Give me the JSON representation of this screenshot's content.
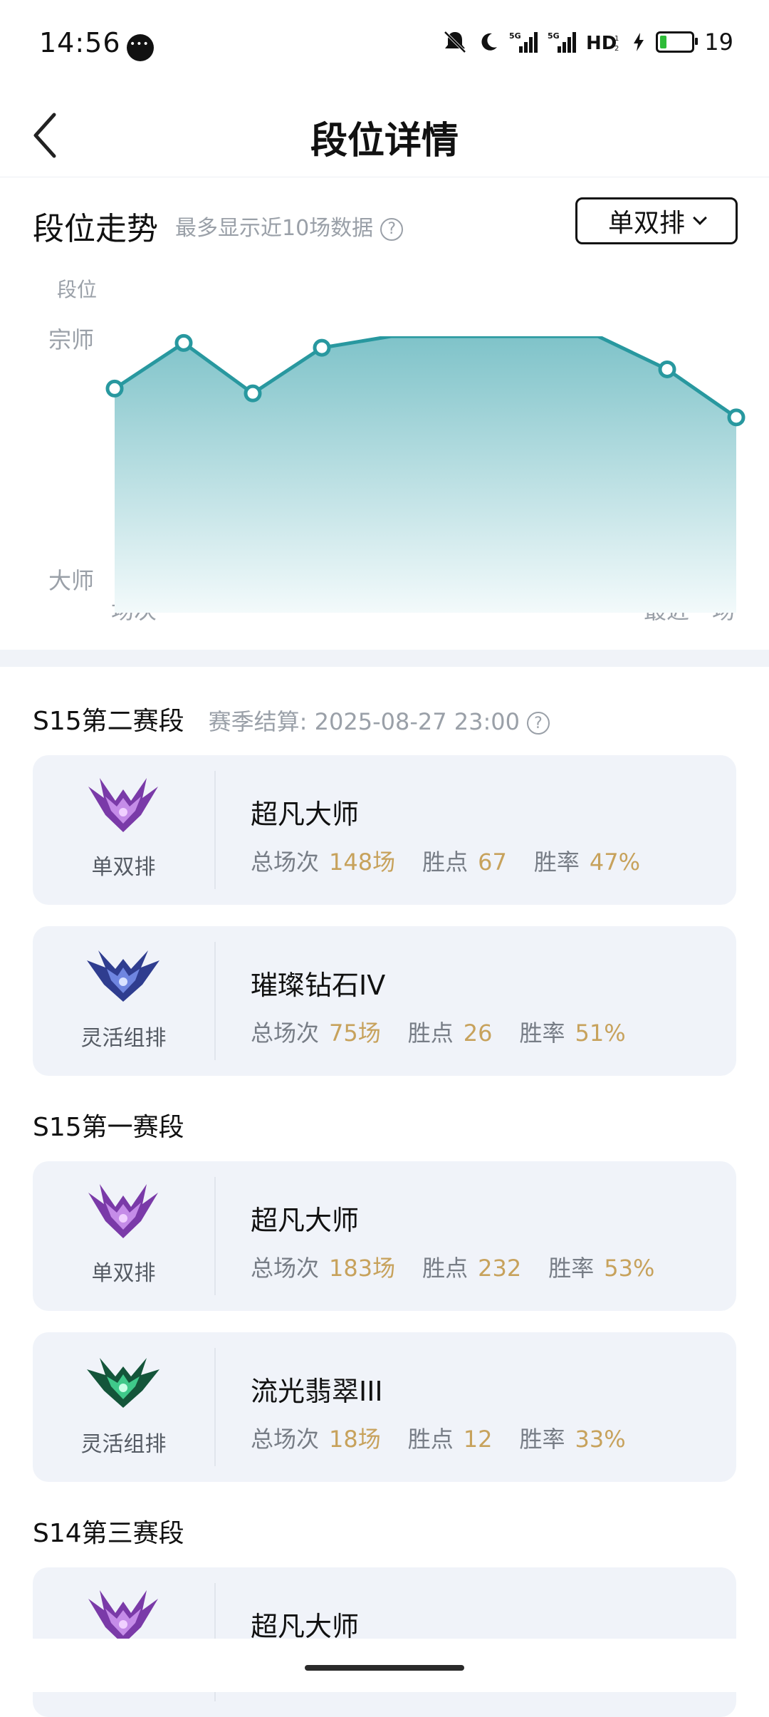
{
  "status_bar": {
    "time": "14:56",
    "network": "5G 5G HD",
    "battery": "19",
    "battery_level": 0.19,
    "icons": [
      "chat-icon",
      "mute-icon",
      "moon-icon",
      "signal-icon",
      "signal-icon",
      "hd-icon",
      "charging-icon",
      "battery-icon"
    ]
  },
  "header": {
    "title": "段位详情",
    "back_icon": "chevron-left-icon"
  },
  "trend": {
    "title": "段位走势",
    "hint": "最多显示近10场数据",
    "help_icon": "question-circle-icon",
    "mode": "单双排",
    "mode_icon": "chevron-down-icon"
  },
  "chart_data": {
    "type": "area",
    "ylabel": "段位",
    "y_ticks": [
      "宗师",
      "大师"
    ],
    "x_ticks": [
      "场次",
      "最近一场"
    ],
    "ylim": [
      0,
      100
    ],
    "grid": false,
    "series": [
      {
        "values": [
          80,
          99,
          78,
          97,
          110,
          110,
          110,
          110,
          88,
          68
        ]
      }
    ],
    "colors": {
      "line": "#28989f",
      "fill_top": "#7fc3c9",
      "fill_bottom": "#f3fafb"
    }
  },
  "seasons": [
    {
      "title": "S15第二赛段",
      "meta": "赛季结算: 2025-08-27 23:00",
      "cards": [
        {
          "queue": "单双排",
          "rank": "超凡大师",
          "games_label": "总场次",
          "games": "148场",
          "lp_label": "胜点",
          "lp": "67",
          "wr_label": "胜率",
          "wr": "47%",
          "emblem": "master-emblem-icon"
        },
        {
          "queue": "灵活组排",
          "rank": "璀璨钻石IV",
          "games_label": "总场次",
          "games": "75场",
          "lp_label": "胜点",
          "lp": "26",
          "wr_label": "胜率",
          "wr": "51%",
          "emblem": "diamond-emblem-icon"
        }
      ]
    },
    {
      "title": "S15第一赛段",
      "cards": [
        {
          "queue": "单双排",
          "rank": "超凡大师",
          "games_label": "总场次",
          "games": "183场",
          "lp_label": "胜点",
          "lp": "232",
          "wr_label": "胜率",
          "wr": "53%",
          "emblem": "master-emblem-icon"
        },
        {
          "queue": "灵活组排",
          "rank": "流光翡翠III",
          "games_label": "总场次",
          "games": "18场",
          "lp_label": "胜点",
          "lp": "12",
          "wr_label": "胜率",
          "wr": "33%",
          "emblem": "emerald-emblem-icon"
        }
      ]
    },
    {
      "title": "S14第三赛段",
      "cards": [
        {
          "queue": "",
          "rank": "超凡大师",
          "emblem": "master-emblem-icon"
        }
      ]
    }
  ]
}
